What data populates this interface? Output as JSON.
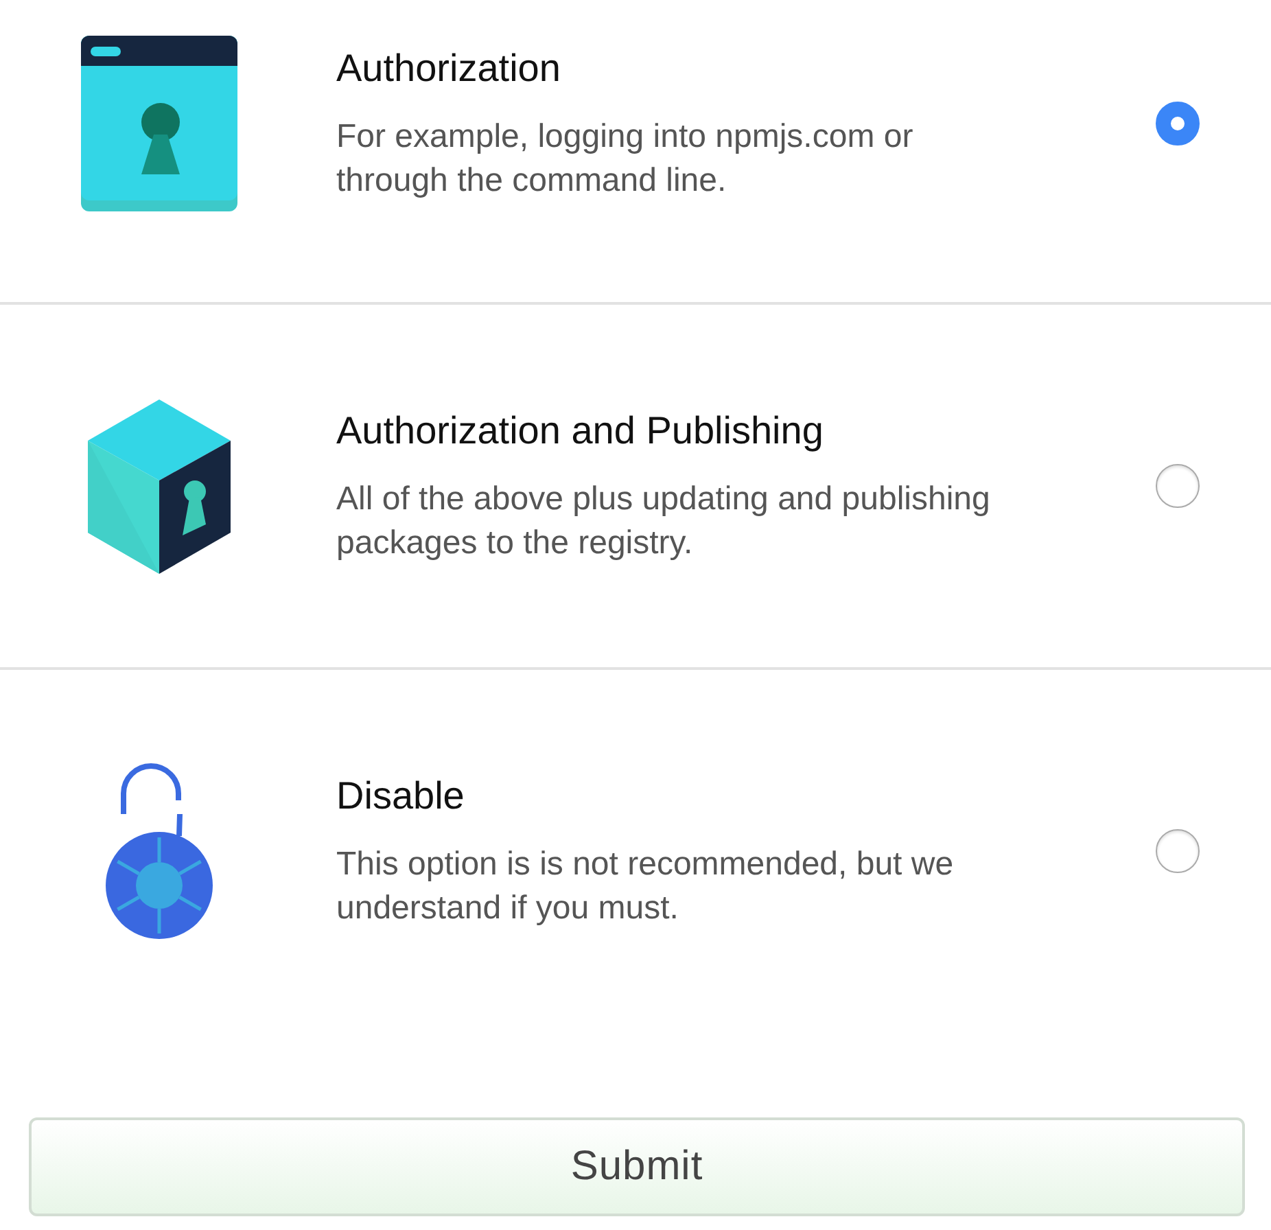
{
  "options": [
    {
      "kind": "window",
      "title": "Authorization",
      "description": "For example, logging into npmjs.com or through the command line.",
      "selected": true
    },
    {
      "kind": "cube",
      "title": "Authorization and Publishing",
      "description": "All of the above plus updating and publishing packages to the registry.",
      "selected": false
    },
    {
      "kind": "padlock",
      "title": "Disable",
      "description": "This option is is not recommended, but we understand if you must.",
      "selected": false
    }
  ],
  "submit": {
    "label": "Submit"
  }
}
